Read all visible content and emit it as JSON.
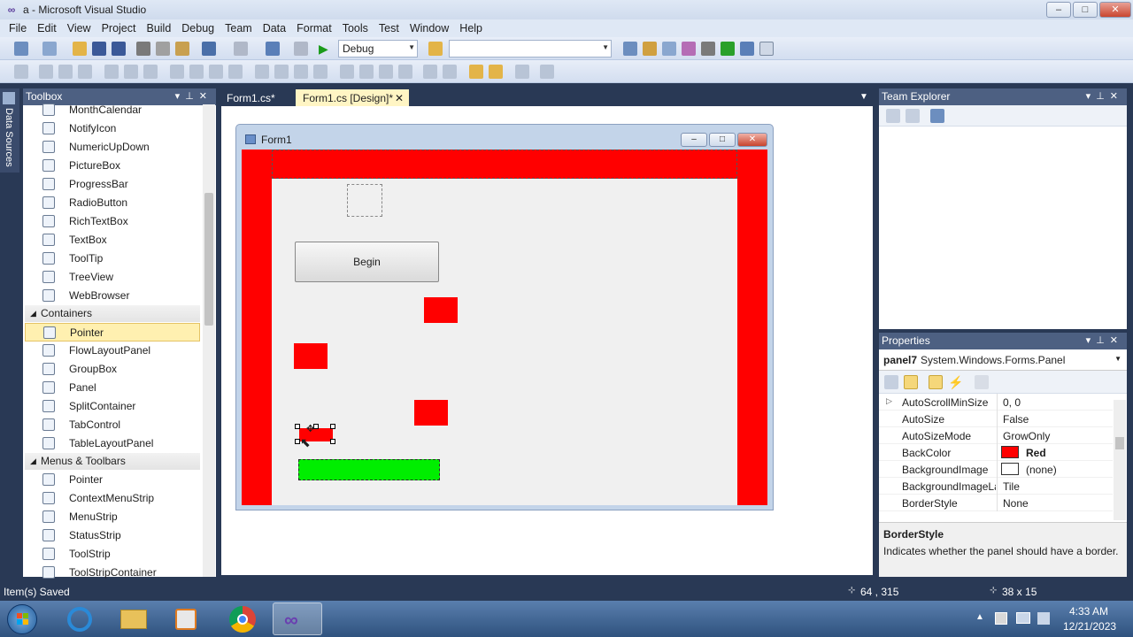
{
  "window": {
    "title": "a - Microsoft Visual Studio",
    "min": "–",
    "max": "□",
    "close": "✕"
  },
  "menu": [
    "File",
    "Edit",
    "View",
    "Project",
    "Build",
    "Debug",
    "Team",
    "Data",
    "Format",
    "Tools",
    "Test",
    "Window",
    "Help"
  ],
  "toolbar": {
    "config_value": "Debug",
    "platform_value": ""
  },
  "datasources": {
    "label": "Data Sources"
  },
  "toolbox": {
    "title": "Toolbox",
    "items_top": [
      "MonthCalendar",
      "NotifyIcon",
      "NumericUpDown",
      "PictureBox",
      "ProgressBar",
      "RadioButton",
      "RichTextBox",
      "TextBox",
      "ToolTip",
      "TreeView",
      "WebBrowser"
    ],
    "group_containers": "Containers",
    "containers": [
      "Pointer",
      "FlowLayoutPanel",
      "GroupBox",
      "Panel",
      "SplitContainer",
      "TabControl",
      "TableLayoutPanel"
    ],
    "group_menus": "Menus & Toolbars",
    "menus": [
      "Pointer",
      "ContextMenuStrip",
      "MenuStrip",
      "StatusStrip",
      "ToolStrip",
      "ToolStripContainer"
    ]
  },
  "tabs": [
    {
      "label": "Form1.cs*"
    },
    {
      "label": "Form1.cs [Design]*"
    }
  ],
  "form": {
    "title": "Form1",
    "button_label": "Begin"
  },
  "team_explorer": {
    "title": "Team Explorer"
  },
  "properties": {
    "title": "Properties",
    "object": "panel7",
    "object_type": "System.Windows.Forms.Panel",
    "rows": [
      {
        "name": "AutoScrollMinSize",
        "value": "0, 0"
      },
      {
        "name": "AutoSize",
        "value": "False"
      },
      {
        "name": "AutoSizeMode",
        "value": "GrowOnly"
      },
      {
        "name": "BackColor",
        "value": "Red"
      },
      {
        "name": "BackgroundImage",
        "value": "(none)"
      },
      {
        "name": "BackgroundImageLa",
        "value": "Tile"
      },
      {
        "name": "BorderStyle",
        "value": "None"
      }
    ],
    "desc_title": "BorderStyle",
    "desc_text": "Indicates whether the panel should have a border."
  },
  "status": {
    "message": "Item(s) Saved",
    "position": "64 , 315",
    "size": "38 x 15"
  },
  "clock": {
    "time": "4:33 AM",
    "date": "12/21/2023"
  },
  "colors": {
    "red": "#ff0000",
    "green": "#00ee00",
    "chrome": "#293955"
  }
}
